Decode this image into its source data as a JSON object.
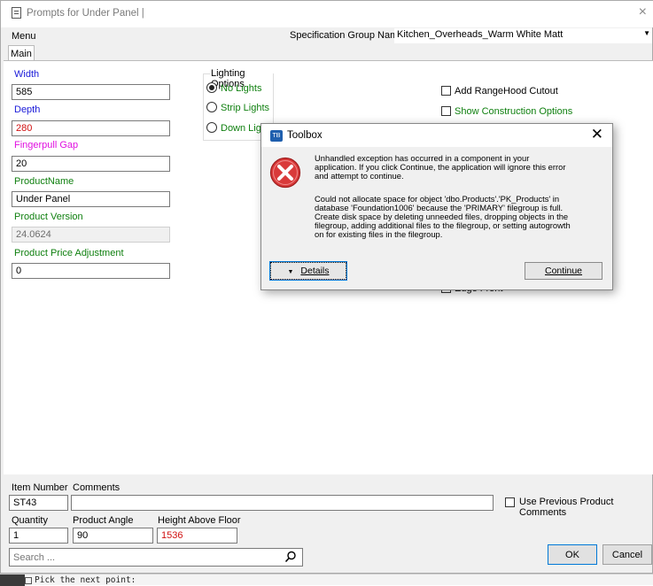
{
  "window": {
    "title": "Prompts for Under Panel |",
    "close_glyph": "×"
  },
  "menu": {
    "label": "Menu"
  },
  "spec": {
    "label": "Specification Group Name",
    "value": "Kitchen_Overheads_Warm White Matt",
    "arrow": "▼"
  },
  "tab": {
    "label": "Main"
  },
  "fields": {
    "width_label": "Width",
    "width_value": "585",
    "depth_label": "Depth",
    "depth_value": "280",
    "fingerpull_label": "Fingerpull Gap",
    "fingerpull_value": "20",
    "productname_label": "ProductName",
    "productname_value": "Under Panel",
    "version_label": "Product Version",
    "version_value": "24.0624",
    "price_label": "Product Price Adjustment",
    "price_value": "0"
  },
  "lighting": {
    "caption": "Lighting Options",
    "options": [
      {
        "label": "No Lights",
        "selected": true
      },
      {
        "label": "Strip Lights",
        "selected": false
      },
      {
        "label": "Down Ligh",
        "selected": false
      }
    ]
  },
  "checks": {
    "rangehood": {
      "label": "Add RangeHood Cutout",
      "checked": false
    },
    "construction": {
      "label": "Show Construction Options",
      "checked": false
    },
    "edge_front": {
      "label": "Edge Front",
      "checked": true
    }
  },
  "dialog": {
    "title": "Toolbox",
    "icon_text": "TB",
    "close_glyph": "✕",
    "message1": "Unhandled exception has occurred in a component in your\napplication. If you click Continue, the application will ignore this error\nand attempt to continue.",
    "message2": "Could not allocate space for object 'dbo.Products'.'PK_Products' in\ndatabase 'Foundation1006' because the 'PRIMARY' filegroup is full.\nCreate disk space by deleting unneeded files, dropping objects in the\nfilegroup, adding additional files to the filegroup, or setting autogrowth\non for existing files in the filegroup.",
    "details_label": "Details",
    "details_arrow": "▼",
    "continue_label": "Continue"
  },
  "bottom": {
    "item_number_label": "Item Number",
    "item_number_value": "ST43",
    "comments_label": "Comments",
    "comments_value": "",
    "use_prev_label": "Use Previous Product Comments",
    "quantity_label": "Quantity",
    "quantity_value": "1",
    "angle_label": "Product Angle",
    "angle_value": "90",
    "height_label": "Height Above Floor",
    "height_value": "1536",
    "search_placeholder": "Search ...",
    "ok_label": "OK",
    "cancel_label": "Cancel"
  },
  "command": {
    "prompt_text": "Pick the next point:"
  },
  "colors": {
    "label_blue": "#1a1ad8",
    "label_red": "#d01010",
    "label_magenta": "#e010e0",
    "label_green": "#108010",
    "error_red": "#d93a3a"
  }
}
